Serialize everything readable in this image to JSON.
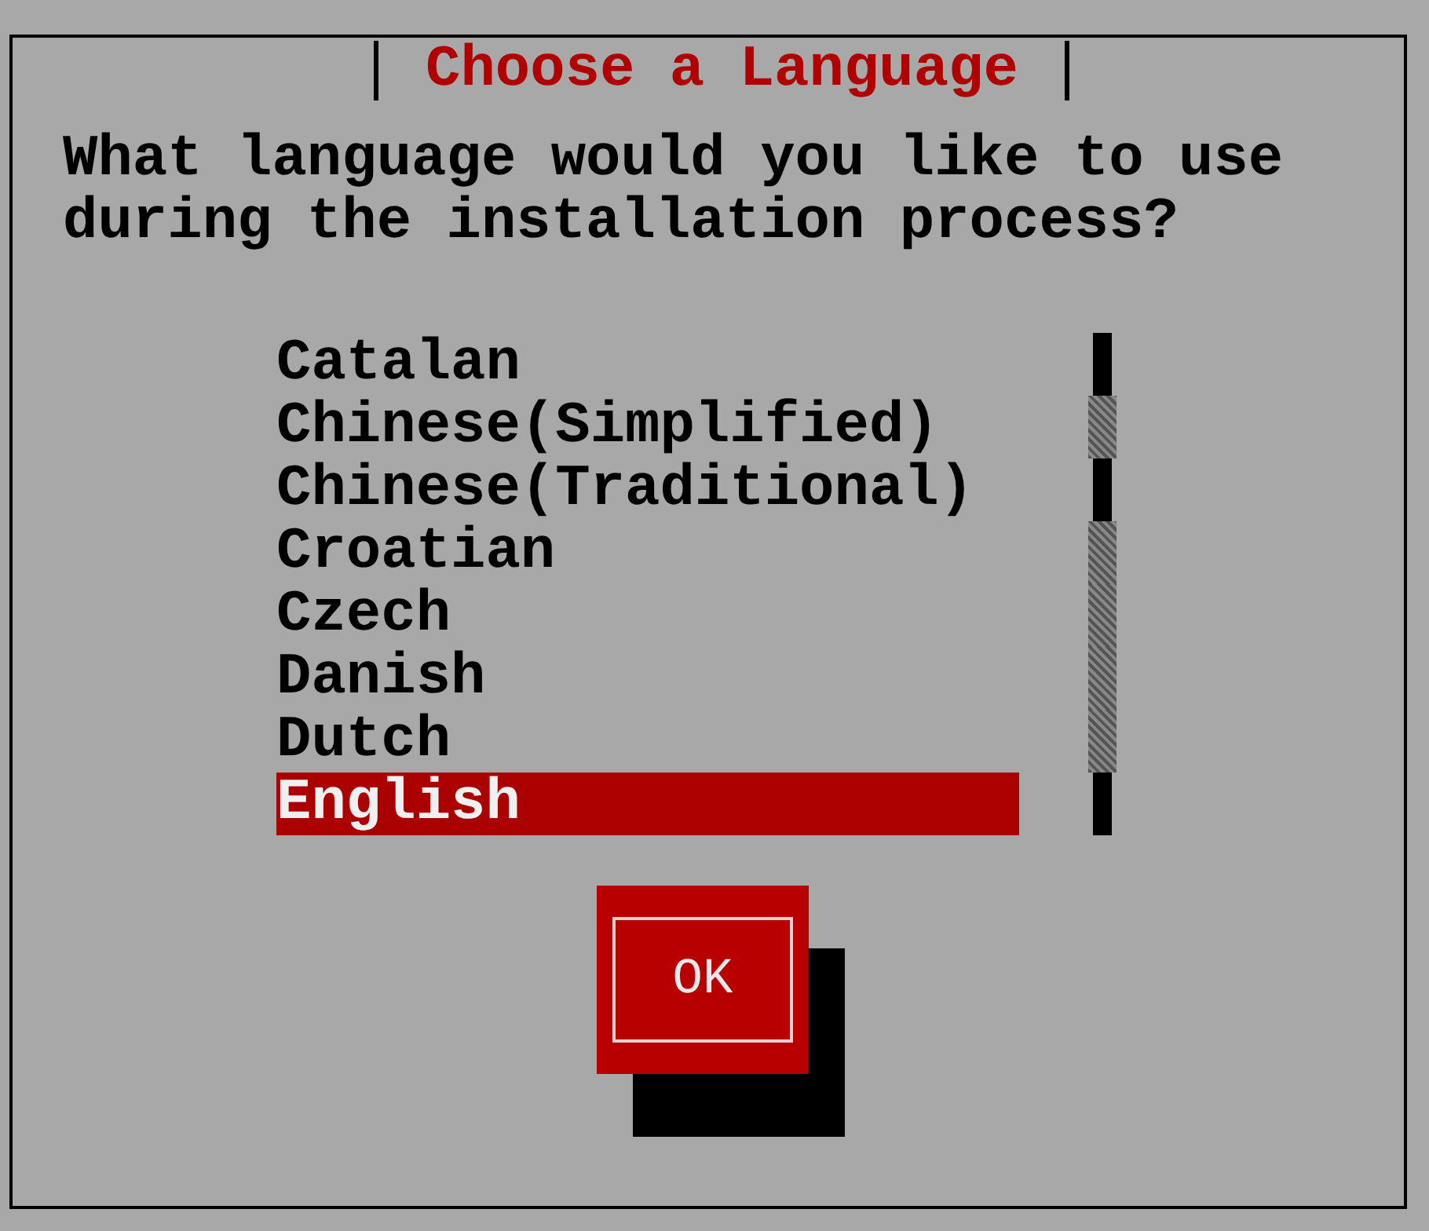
{
  "dialog": {
    "title": "Choose a Language",
    "prompt": "What language would you like to use during the installation process?",
    "languages": [
      {
        "label": "Catalan",
        "selected": false
      },
      {
        "label": "Chinese(Simplified)",
        "selected": false
      },
      {
        "label": "Chinese(Traditional)",
        "selected": false
      },
      {
        "label": "Croatian",
        "selected": false
      },
      {
        "label": "Czech",
        "selected": false
      },
      {
        "label": "Danish",
        "selected": false
      },
      {
        "label": "Dutch",
        "selected": false
      },
      {
        "label": "English",
        "selected": true
      }
    ],
    "buttons": [
      "OK"
    ]
  }
}
